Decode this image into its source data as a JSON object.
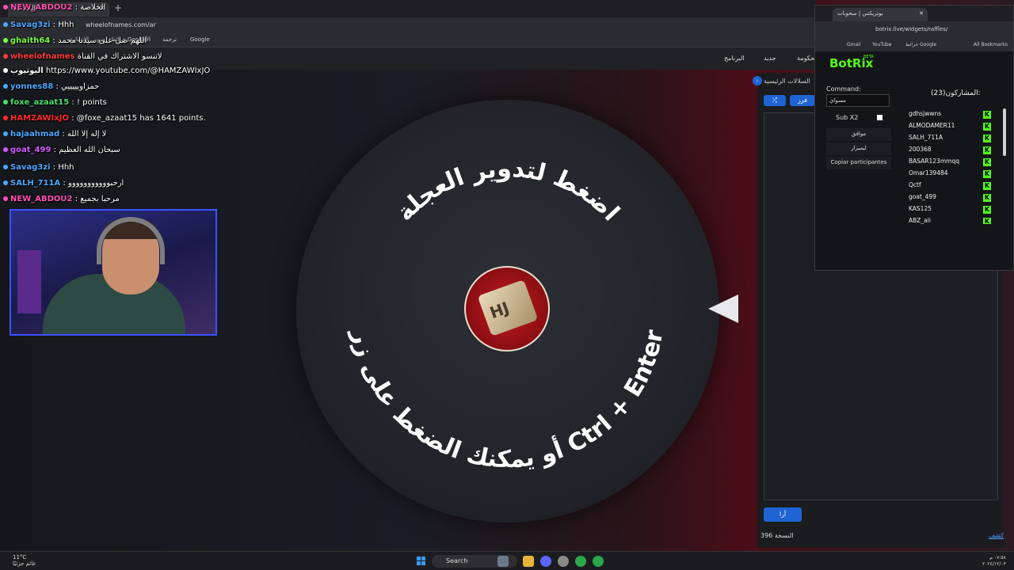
{
  "browser": {
    "tab_title": "الخلاصة",
    "url": "wheelofnames.com/ar",
    "bookmarks": [
      "الإنسانية",
      "صور",
      "خرائط Google",
      "الأخبار",
      "ترجمة",
      "Google"
    ]
  },
  "wheel_toolbar": {
    "items": [
      "الحكومة",
      "جديد",
      "البرنامج"
    ]
  },
  "chat": [
    {
      "user": "NEW_ABDOU2",
      "text": ": الخلاصة",
      "color": "#ff4fb5"
    },
    {
      "user": "Savag3zi",
      "text": ": Hhh",
      "color": "#4ba7ff"
    },
    {
      "user": "ghaith64",
      "text": ": اللهم صل على سيدنا محمد",
      "color": "#7dff4a"
    },
    {
      "user": "wheelofnames",
      "text": "لاتنسو الاشتراك في القناة",
      "color": "#ff3b3b"
    },
    {
      "user": "اليوتيوب",
      "text": "https://www.youtube.com/@HAMZAWIxJO",
      "color": "#ffffff"
    },
    {
      "user": "yonnes88",
      "text": ": حمزاويييييي",
      "color": "#4ba7ff"
    },
    {
      "user": "foxe_azaat15",
      "text": ": ! points",
      "color": "#4adf6a"
    },
    {
      "user": "HAMZAWIxJO",
      "text": ": @foxe_azaat15 has 1641 points.",
      "color": "#ff2a2a"
    },
    {
      "user": "hajaahmad",
      "text": ": لا إله إلا الله",
      "color": "#4ba7ff"
    },
    {
      "user": "goat_499",
      "text": ": سبحان الله العظيم",
      "color": "#d05cff"
    },
    {
      "user": "Savag3zi",
      "text": ": Hhh",
      "color": "#4ba7ff"
    },
    {
      "user": "SALH_711A",
      "text": ": ارحبووووووووووو",
      "color": "#4ba7ff"
    },
    {
      "user": "NEW_ABDOU2",
      "text": ": مرحبا بجميع",
      "color": "#ff4fb5"
    }
  ],
  "wheel": {
    "top_text": "اضغط لتدوير العجلة",
    "bottom_text": "أو يمكنك الضغط على زر Ctrl + Enter"
  },
  "right_panel": {
    "tab_label": "السلالات الرئيسية",
    "shuffle_icon": "shuffle-icon",
    "sort_label": "فرز",
    "add_label": "أرا",
    "count_text": "396 النسخة",
    "footer_link": "كشف"
  },
  "botrix_window": {
    "tab_title": "بوتريكس | سحوبات",
    "url": "botrix.live/widgets/raffles/",
    "bookmarks": [
      "Gmail",
      "YouTube",
      "خرائط Google",
      "All Bookmarks"
    ],
    "brand": "BotRix",
    "beta": "BETA",
    "command_label": "Command:",
    "command_value": "مسواي",
    "sub_label": "Sub X2",
    "buttons": [
      "موافق",
      "ليميزار",
      "Copiar participantes"
    ],
    "participants_label": "(23)المشاركون:",
    "participants": [
      "gdhsjwwns",
      "ALMODAMER11",
      "SALH_711A",
      "200368",
      "BASAR123mmqq",
      "Omar139484",
      "Qctf",
      "goat_499",
      "KAS125",
      "ABZ_ali"
    ]
  },
  "taskbar": {
    "weather_temp": "11°C",
    "weather_desc": "غائم جزئيًا",
    "search_label": "Search",
    "time": "٠٧:٥٨ م",
    "date": "٢٠٢٤/١٢/٠٣"
  },
  "colors": {
    "brand_green": "#53fc18",
    "accent_blue": "#1e64d4"
  }
}
